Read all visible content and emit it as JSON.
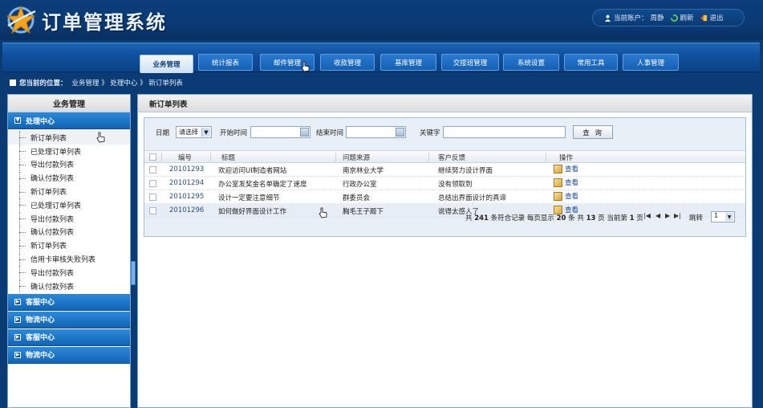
{
  "header": {
    "title": "订单管理系统",
    "user_label": "当前账户：",
    "user_name": "周静",
    "refresh_label": "刷新",
    "logout_label": "退出"
  },
  "nav": {
    "tabs": [
      "业务管理",
      "统计报表",
      "邮件管理",
      "收款管理",
      "基库管理",
      "交接班管理",
      "系统设置",
      "常用工具",
      "人事管理"
    ],
    "active_index": 0
  },
  "breadcrumb": {
    "label": "您当前的位置：",
    "path": "业务管理 》 处理中心 》 新订单列表"
  },
  "sidebar": {
    "title": "业务管理",
    "open_group": "处理中心",
    "items": [
      "新订单列表",
      "已处理订单列表",
      "导出付款列表",
      "确认付款列表",
      "新订单列表",
      "已处理订单列表",
      "导出付款列表",
      "确认付款列表",
      "新订单列表",
      "信用卡审核失败列表",
      "导出付款列表",
      "确认付款列表"
    ],
    "closed_groups": [
      "客服中心",
      "物流中心",
      "客服中心",
      "物流中心"
    ]
  },
  "main": {
    "title": "新订单列表",
    "filter": {
      "date_label": "日期",
      "date_select": "请选择",
      "start_label": "开始时间",
      "end_label": "结束时间",
      "keyword_label": "关键字",
      "search_button": "查 询"
    },
    "columns": [
      "编号",
      "标题",
      "问题来源",
      "客户反馈",
      "操作"
    ],
    "rows": [
      {
        "id": "20101293",
        "title": "欢迎访问UI制造者网站",
        "source": "南京林业大学",
        "feedback": "继续努力设计界面",
        "action": "查看"
      },
      {
        "id": "20101294",
        "title": "办公室发奖金名单确定了速度",
        "source": "行政办公室",
        "feedback": "没有领取到",
        "action": "查看"
      },
      {
        "id": "20101295",
        "title": "设计一定要注意细节",
        "source": "群委员会",
        "feedback": "总结出界面设计的真谛",
        "action": "查看"
      },
      {
        "id": "20101296",
        "title": "如何做好界面设计工作",
        "source": "胸毛王子殿下",
        "feedback": "说得太感人了",
        "action": "查看"
      }
    ],
    "pager": {
      "total_text": "共",
      "total": "241",
      "total_suffix": "条符合记录",
      "per_page_text": "每页显示",
      "per_page": "20",
      "per_page_suffix": "条",
      "pages_text": "共",
      "pages": "13",
      "pages_suffix": "页",
      "current_text": "当前第",
      "current": "1",
      "current_suffix": "页",
      "jump_label": "跳转",
      "jump_value": "1"
    }
  },
  "colors": {
    "background": "#0b3b73",
    "nav_blue": "#1560b3",
    "group_blue": "#1264b5",
    "panel_border": "#7aa6d6",
    "alt_row": "#e6edf6"
  }
}
